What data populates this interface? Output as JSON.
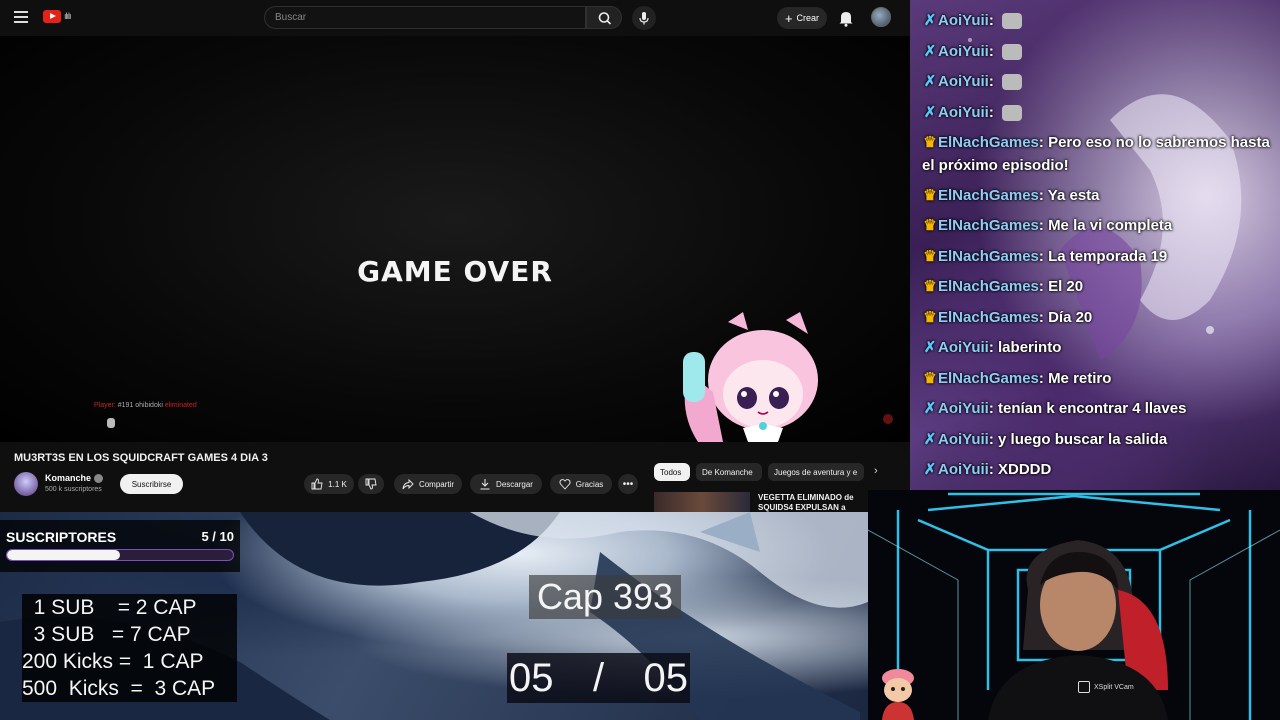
{
  "youtube": {
    "search_placeholder": "Buscar",
    "create_label": "Crear",
    "player": {
      "overlay_text": "GAME OVER",
      "chat_snippet_user": "Player:",
      "chat_snippet_msg": "#191 ohibidoki",
      "chat_snippet_tag": "eliminated"
    },
    "video_title": "MU3RT3S EN LOS SQUIDCRAFT GAMES 4 DIA 3",
    "channel_name": "Komanche",
    "channel_subs": "500 k suscriptores",
    "subscribe_label": "Suscribirse",
    "like_count": "1.1 K",
    "share_label": "Compartir",
    "download_label": "Descargar",
    "thanks_label": "Gracias",
    "chips": [
      "Todos",
      "De Komanche",
      "Juegos de aventura y e"
    ],
    "rec_title_1": "VEGETTA ELIMINADO de",
    "rec_title_2": "SQUIDS4 EXPULSAN a"
  },
  "chat": {
    "messages": [
      {
        "badge": "sword",
        "user": "AoiYuii",
        "text": "",
        "emote": true
      },
      {
        "badge": "sword",
        "user": "AoiYuii",
        "text": "",
        "emote": true
      },
      {
        "badge": "sword",
        "user": "AoiYuii",
        "text": "",
        "emote": true
      },
      {
        "badge": "sword",
        "user": "AoiYuii",
        "text": "",
        "emote": true
      },
      {
        "badge": "crown",
        "user": "ElNachGames",
        "text": "Pero eso no lo sabremos hasta el próximo episodio!",
        "emote": false
      },
      {
        "badge": "crown",
        "user": "ElNachGames",
        "text": "Ya esta",
        "emote": false
      },
      {
        "badge": "crown",
        "user": "ElNachGames",
        "text": "Me la vi completa",
        "emote": false
      },
      {
        "badge": "crown",
        "user": "ElNachGames",
        "text": "La temporada 19",
        "emote": false
      },
      {
        "badge": "crown",
        "user": "ElNachGames",
        "text": "El 20",
        "emote": false
      },
      {
        "badge": "crown",
        "user": "ElNachGames",
        "text": "Día 20",
        "emote": false
      },
      {
        "badge": "sword",
        "user": "AoiYuii",
        "text": "laberinto",
        "emote": false
      },
      {
        "badge": "crown",
        "user": "ElNachGames",
        "text": "Me retiro",
        "emote": false
      },
      {
        "badge": "sword",
        "user": "AoiYuii",
        "text": "tenían k encontrar 4 llaves",
        "emote": false
      },
      {
        "badge": "sword",
        "user": "AoiYuii",
        "text": "y luego buscar la salida",
        "emote": false
      },
      {
        "badge": "sword",
        "user": "AoiYuii",
        "text": "XDDDD",
        "emote": false
      }
    ]
  },
  "overlay": {
    "subs_title": "SUSCRIPTORES",
    "subs_current": "5",
    "subs_goal": "10",
    "subs_count_text": "5 / 10",
    "subs_progress": 0.5,
    "rates": [
      "  1 SUB    = 2 CAP",
      "  3 SUB   = 7 CAP",
      "200 Kicks =  1 CAP",
      "500  Kicks  =  3 CAP"
    ],
    "cap_label": "Cap 393",
    "ep_current": "05",
    "ep_sep": "/",
    "ep_total": "05"
  },
  "webcam": {
    "xsplit_label": "XSplit VCam"
  },
  "colors": {
    "yt_red": "#e62117",
    "chat_user": "#8ecdf5",
    "sword_badge": "#5ac8fa",
    "crown_badge": "#f5b800",
    "neon": "#3fd8ff",
    "bar_border": "#7d4fc0"
  }
}
